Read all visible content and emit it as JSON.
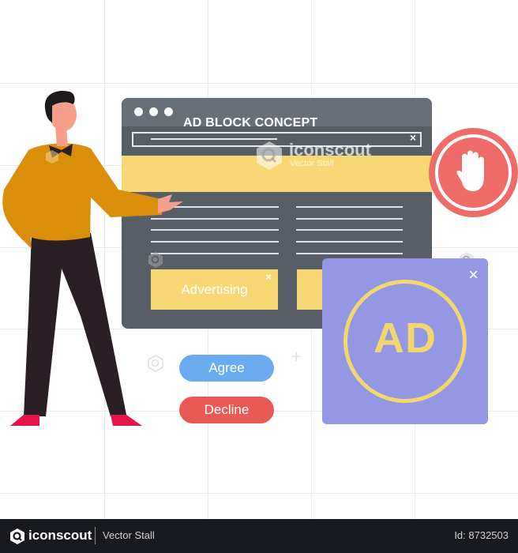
{
  "illustration": {
    "title": "AD BLOCK CONCEPT",
    "address_bar_close": "×",
    "ad_slot": {
      "label": "Advertising",
      "close": "×"
    },
    "popup": {
      "label": "AD",
      "close": "×"
    },
    "stop_icon": "hand-stop-icon",
    "buttons": {
      "agree": "Agree",
      "decline": "Decline"
    },
    "colors": {
      "window": "#575e66",
      "banner": "#f7d874",
      "popup": "#9397e6",
      "stop": "#ee6b68",
      "agree": "#6aacef",
      "decline": "#ea5a55",
      "sweater": "#d98f0a"
    }
  },
  "watermark": {
    "brand": "iconscout",
    "author": "Vector Stall"
  },
  "footer": {
    "brand": "iconscout",
    "author": "Vector Stall",
    "id": "Id: 8732503"
  }
}
